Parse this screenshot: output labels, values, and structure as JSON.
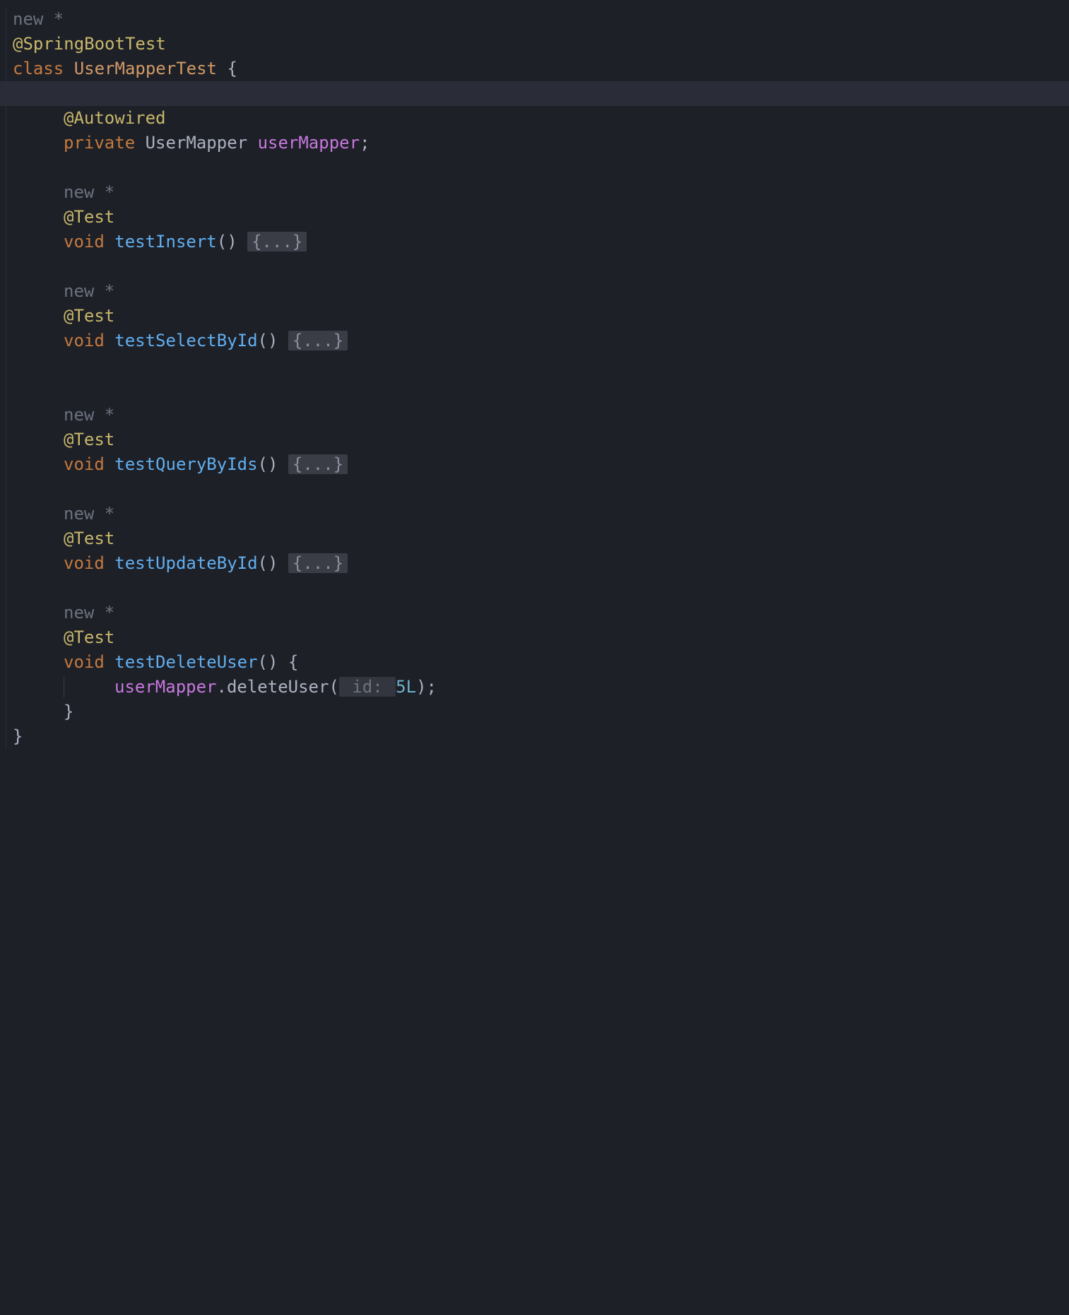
{
  "hints": {
    "new_marker": "new *"
  },
  "annotations": {
    "spring_boot_test": "@SpringBootTest",
    "autowired": "@Autowired",
    "test": "@Test"
  },
  "keywords": {
    "class": "class",
    "private": "private",
    "void": "void"
  },
  "class_declaration": {
    "name": "UserMapperTest",
    "open_brace": " {",
    "close_brace": "}"
  },
  "field": {
    "type": "UserMapper",
    "name": "userMapper",
    "semicolon": ";"
  },
  "methods": {
    "testInsert": {
      "name": "testInsert",
      "parens": "() ",
      "folded": "{...}"
    },
    "testSelectById": {
      "name": "testSelectById",
      "parens": "() ",
      "folded": "{...}"
    },
    "testQueryByIds": {
      "name": "testQueryByIds",
      "parens": "() ",
      "folded": "{...}"
    },
    "testUpdateById": {
      "name": "testUpdateById",
      "parens": "() ",
      "folded": "{...}"
    },
    "testDeleteUser": {
      "name": "testDeleteUser",
      "parens_open": "() {",
      "body": {
        "target": "userMapper",
        "dot": ".",
        "method": "deleteUser",
        "open_paren": "(",
        "param_hint": " id: ",
        "arg_value": "5L",
        "close": ");"
      },
      "close_brace": "}"
    }
  },
  "spacing": {
    "space": " "
  }
}
